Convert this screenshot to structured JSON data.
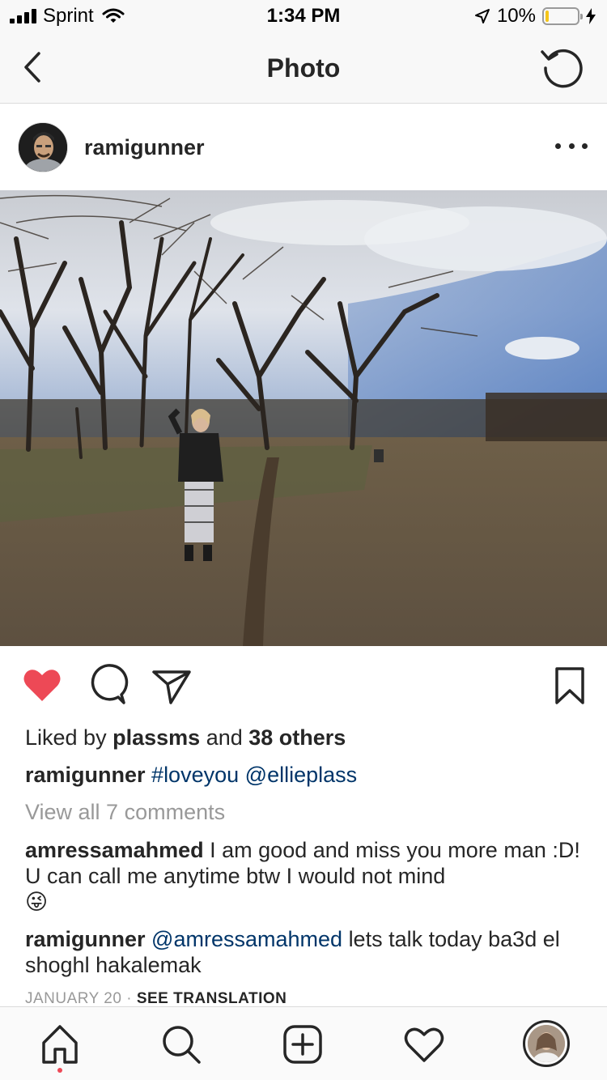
{
  "status_bar": {
    "carrier": "Sprint",
    "time": "1:34 PM",
    "battery_percent": "10%",
    "battery_level": 0.1,
    "battery_color": "#f5c518"
  },
  "nav": {
    "title": "Photo",
    "back_icon": "chevron-left-icon",
    "refresh_icon": "refresh-icon"
  },
  "post": {
    "username": "ramigunner",
    "liked": true,
    "like_color": "#ed4956",
    "likes": {
      "prefix": "Liked by",
      "liker": "plassms",
      "conj": "and",
      "others": "38 others"
    },
    "caption": {
      "username": "ramigunner",
      "hashtag": "#loveyou",
      "mention": "@ellieplass"
    },
    "view_all": "View all 7 comments",
    "comments": [
      {
        "username": "amressamahmed",
        "text": "I am good and miss you more man :D! U can call me anytime btw I would not mind",
        "emoji": "😜"
      },
      {
        "username": "ramigunner",
        "mention": "@amressamahmed",
        "text": "lets talk today ba3d el shoghl hakalemak"
      }
    ],
    "date": "JANUARY 20",
    "separator": "·",
    "see_translation": "SEE TRANSLATION"
  },
  "tab_bar": {
    "items": [
      "home-icon",
      "search-icon",
      "add-icon",
      "heart-icon",
      "profile-avatar"
    ]
  },
  "colors": {
    "link": "#003569",
    "muted": "#999999",
    "notification_dot": "#ed4956"
  }
}
